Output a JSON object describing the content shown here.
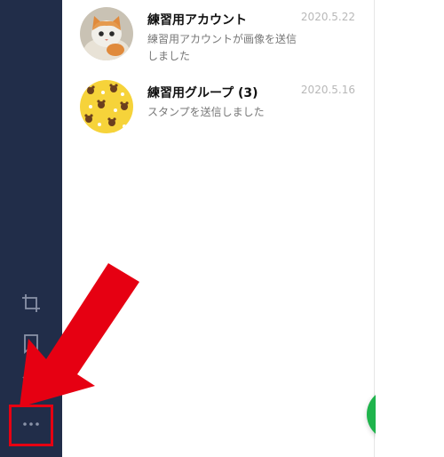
{
  "sidebar": {
    "icons": [
      {
        "name": "crop-icon"
      },
      {
        "name": "bookmark-icon"
      },
      {
        "name": "mute-icon"
      },
      {
        "name": "more-icon"
      }
    ],
    "icon_color": "#8a93a8",
    "bg_color": "#212d49"
  },
  "chats": [
    {
      "name": "練習用アカウント",
      "preview_line1": "練習用アカウントが画像を送信",
      "preview_line2": "しました",
      "date": "2020.5.22",
      "avatar": "kitten-avatar"
    },
    {
      "name": "練習用グループ (3)",
      "preview_line1": "スタンプを送信しました",
      "date": "2020.5.16",
      "avatar": "bear-pattern-avatar"
    }
  ],
  "compose_button": {
    "icon": "new-chat-icon",
    "color": "#1fb44c"
  },
  "annotation": {
    "highlight_color": "#e60012"
  }
}
